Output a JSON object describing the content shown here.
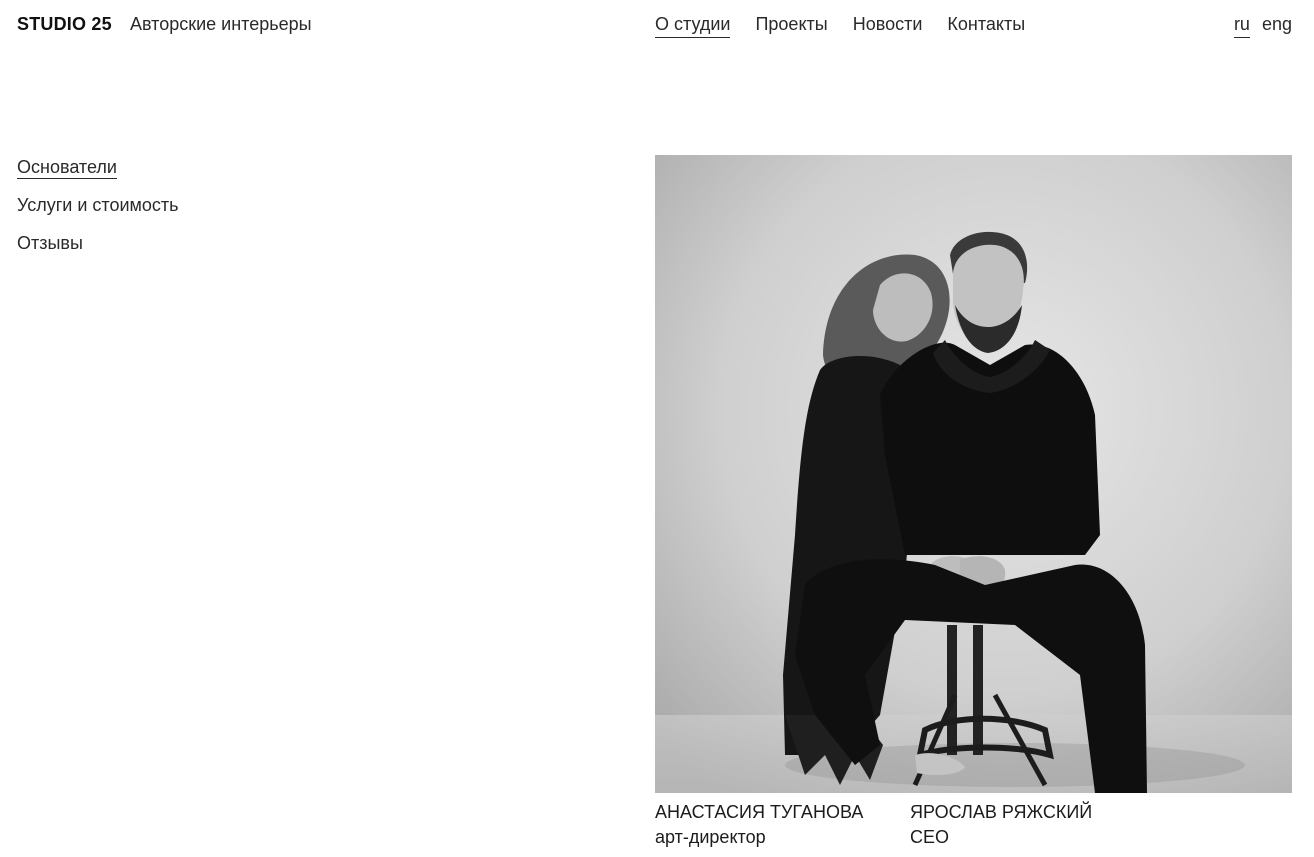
{
  "header": {
    "logo": "STUDIO 25",
    "tagline": "Авторские интерьеры",
    "nav": [
      {
        "label": "О студии",
        "active": true
      },
      {
        "label": "Проекты",
        "active": false
      },
      {
        "label": "Новости",
        "active": false
      },
      {
        "label": "Контакты",
        "active": false
      }
    ],
    "languages": [
      {
        "label": "ru",
        "active": true
      },
      {
        "label": "eng",
        "active": false
      }
    ]
  },
  "side_nav": [
    {
      "label": "Основатели",
      "active": true
    },
    {
      "label": "Услуги и стоимость",
      "active": false
    },
    {
      "label": "Отзывы",
      "active": false
    }
  ],
  "founders": [
    {
      "name": "АНАСТАСИЯ ТУГАНОВА",
      "role": "арт-директор"
    },
    {
      "name": "ЯРОСЛАВ РЯЖСКИЙ",
      "role": "CEO"
    }
  ]
}
